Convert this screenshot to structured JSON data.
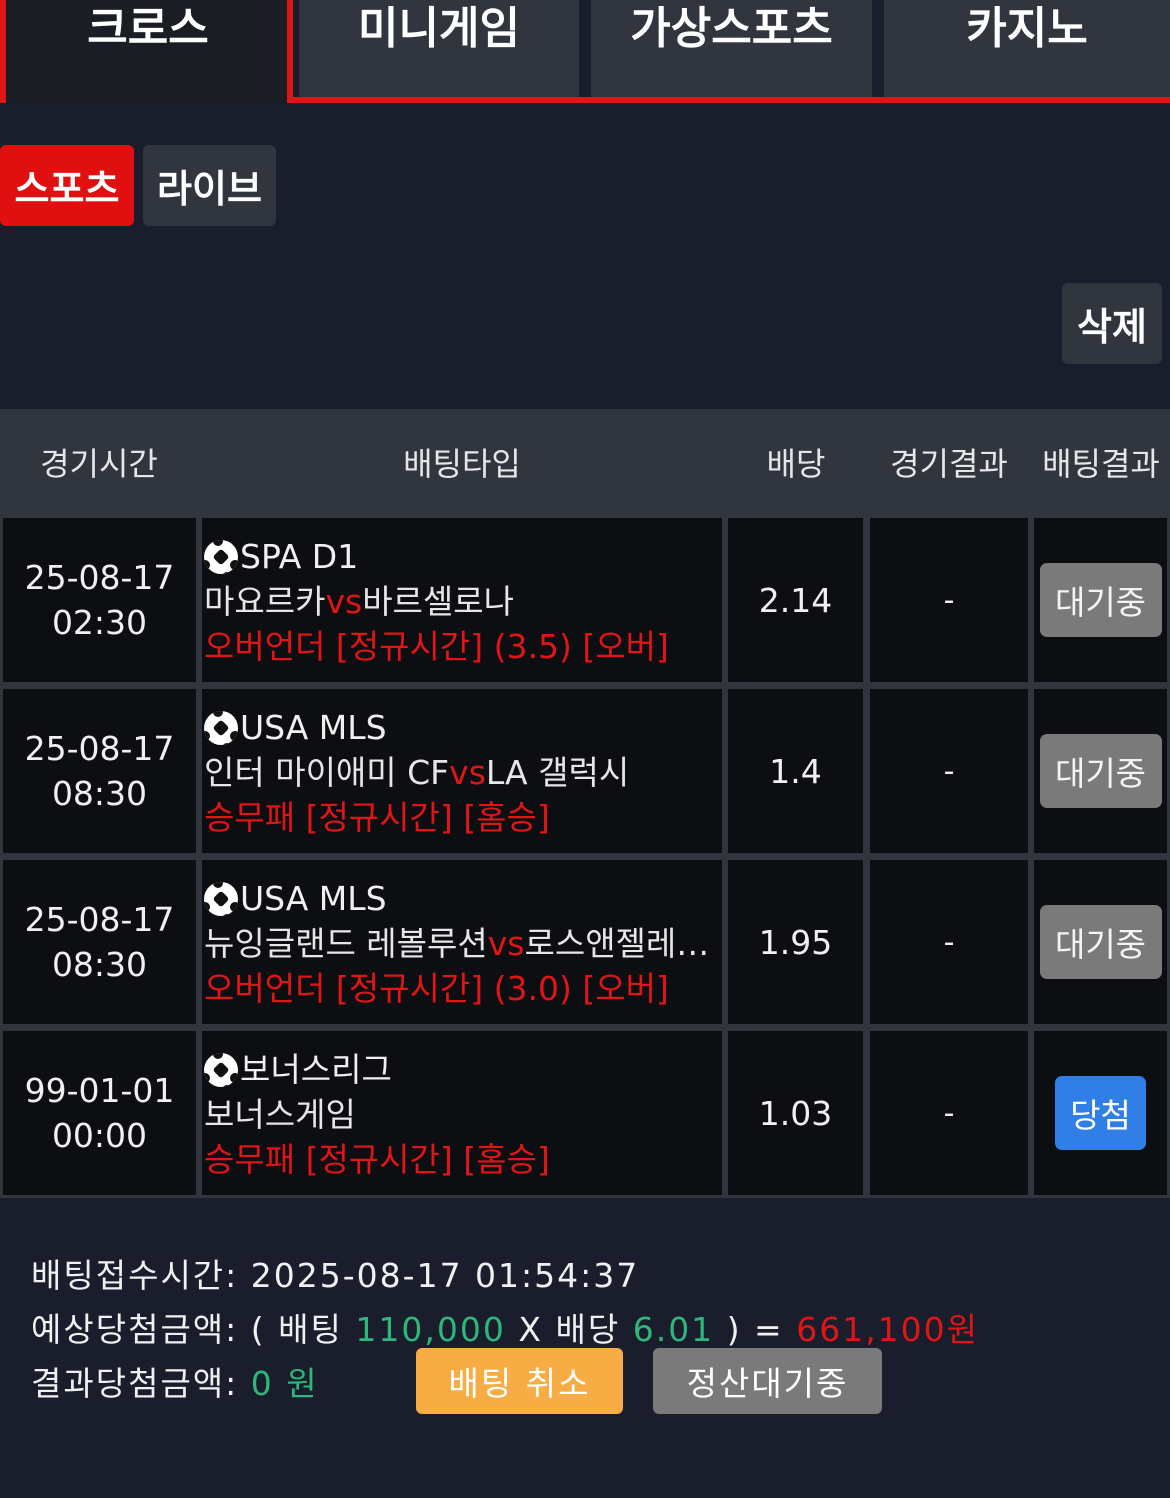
{
  "top_tabs": [
    {
      "label": "크로스",
      "active": true
    },
    {
      "label": "미니게임"
    },
    {
      "label": "가상스포츠"
    },
    {
      "label": "카지노"
    }
  ],
  "sub_tabs": [
    {
      "label": "스포츠",
      "active": true
    },
    {
      "label": "라이브"
    }
  ],
  "delete_label": "삭제",
  "table": {
    "headers": [
      "경기시간",
      "배팅타입",
      "배당",
      "경기결과",
      "배팅결과"
    ],
    "rows": [
      {
        "date": "25-08-17",
        "time": "02:30",
        "league": "SPA D1",
        "home": "마요르카",
        "vs": "vs",
        "away": "바르셀로나",
        "bet": "오버언더 [정규시간] (3.5) [오버]",
        "odds": "2.14",
        "result": "-",
        "status": "대기중"
      },
      {
        "date": "25-08-17",
        "time": "08:30",
        "league": "USA MLS",
        "home": "인터 마이애미 CF",
        "vs": "vs",
        "away": "LA 갤럭시",
        "bet": "승무패 [정규시간] [홈승]",
        "odds": "1.4",
        "result": "-",
        "status": "대기중"
      },
      {
        "date": "25-08-17",
        "time": "08:30",
        "league": "USA MLS",
        "home": "뉴잉글랜드 레볼루션",
        "vs": "vs",
        "away": "로스앤젤레…",
        "bet": "오버언더 [정규시간] (3.0) [오버]",
        "odds": "1.95",
        "result": "-",
        "status": "대기중"
      },
      {
        "date": "99-01-01",
        "time": "00:00",
        "league": "보너스리그",
        "home": "보너스게임",
        "vs": "",
        "away": "",
        "bet": "승무패 [정규시간] [홈승]",
        "odds": "1.03",
        "result": "-",
        "status": "당첨"
      }
    ]
  },
  "footer": {
    "received_label": "배팅접수시간:",
    "received_value": "2025-08-17 01:54:37",
    "expected_label": "예상당첨금액:",
    "open_paren": "(",
    "bet_word": "배팅",
    "bet_amount": "110,000",
    "times": "X",
    "odds_word": "배당",
    "total_odds": "6.01",
    "close_eq": ") =",
    "expected_amount": "661,100원",
    "result_label": "결과당첨금액:",
    "result_amount": "0 원",
    "cancel_label": "배팅 취소",
    "settle_label": "정산대기중"
  },
  "colors": {
    "accent_red": "#e01515",
    "win_blue": "#2f7fe6",
    "cancel_orange": "#f7ad43",
    "money_green": "#2db77a"
  }
}
